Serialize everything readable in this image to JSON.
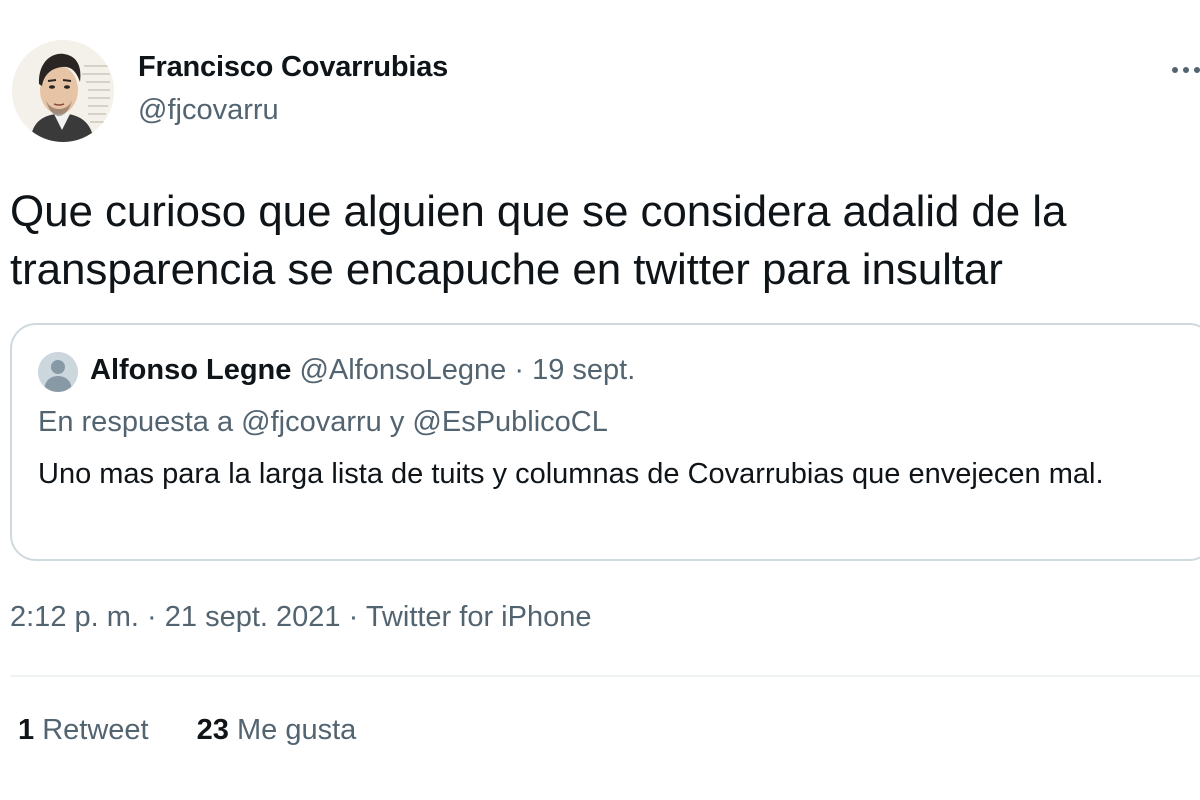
{
  "tweet": {
    "author": {
      "display_name": "Francisco Covarrubias",
      "handle": "@fjcovarru",
      "avatar_icon": "user-avatar-illustration"
    },
    "text": "Que curioso que alguien que se considera adalid de la transparencia se encapuche en twitter para insultar",
    "more_icon": "more-options-icon",
    "quoted_tweet": {
      "author_name": "Alfonso Legne",
      "author_handle": "@AlfonsoLegne",
      "separator": "·",
      "date": "19 sept.",
      "reply_prefix": "En respuesta a",
      "reply_to_1": "@fjcovarru",
      "reply_conjunction": "y",
      "reply_to_2": "@EsPublicoCL",
      "text": "Uno mas para la larga lista de tuits y columnas de Covarrubias que envejecen mal.",
      "avatar_icon": "default-avatar-icon"
    },
    "meta": {
      "time": "2:12 p. m.",
      "separator": "·",
      "date": "21 sept. 2021",
      "source": "Twitter for iPhone"
    },
    "stats": {
      "retweets_count": "1",
      "retweets_label": "Retweet",
      "likes_count": "23",
      "likes_label": "Me gusta"
    }
  },
  "colors": {
    "text_primary": "#0f1419",
    "text_secondary": "#536471",
    "border": "#cfd9de",
    "divider": "#eff3f4"
  }
}
